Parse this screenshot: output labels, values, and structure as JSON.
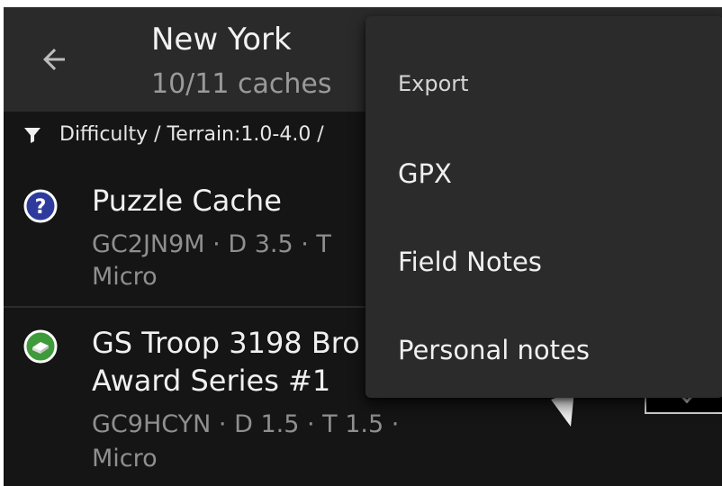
{
  "toolbar": {
    "title": "New York",
    "subtitle": "10/11 caches",
    "back_icon": "arrow-left-icon"
  },
  "filter": {
    "icon": "filter-icon",
    "text": "Difficulty / Terrain:1.0-4.0 /"
  },
  "caches": [
    {
      "icon": "mystery-cache-icon",
      "icon_color": "#2f3b9c",
      "name": "Puzzle Cache",
      "info_line1": "GC2JN9M · D 3.5 · T",
      "info_line2": "Micro"
    },
    {
      "icon": "traditional-cache-icon",
      "icon_color": "#3f9a3a",
      "name_line1": "GS Troop 3198 Bro",
      "name_line2": "Award Series #1",
      "info_line1": "GC9HCYN · D 1.5 · T 1.5 ·",
      "info_line2": "Micro",
      "direction_icon": "direction-arrow-icon"
    }
  ],
  "menu": {
    "header": "Export",
    "items": [
      {
        "label": "GPX"
      },
      {
        "label": "Field Notes"
      },
      {
        "label": "Personal notes"
      }
    ]
  }
}
